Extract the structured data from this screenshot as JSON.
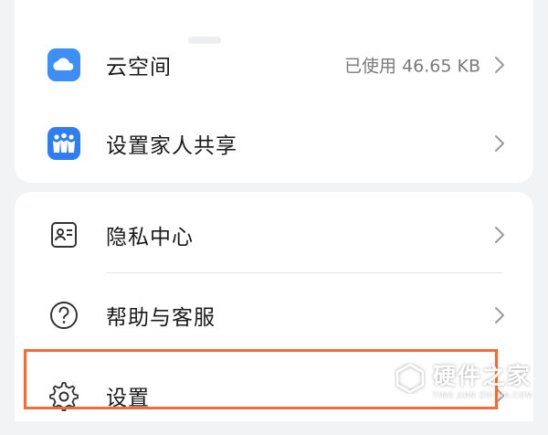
{
  "menu": {
    "cloud": {
      "label": "云空间",
      "value": "已使用 46.65 KB"
    },
    "family": {
      "label": "设置家人共享"
    },
    "privacy": {
      "label": "隐私中心"
    },
    "help": {
      "label": "帮助与客服"
    },
    "settings": {
      "label": "设置"
    }
  },
  "watermark": {
    "title": "硬件之家",
    "subtitle": "YING JIAN ZHI JIA.COM"
  },
  "colors": {
    "cloud_icon": "#3d8ef5",
    "family_icon": "#2f7ef0",
    "highlight_border": "#ee6d3a",
    "chevron": "#9a9a9a"
  },
  "icons": {
    "cloud": "cloud-icon",
    "family": "family-share-icon",
    "privacy": "privacy-id-card-icon",
    "help": "question-circle-icon",
    "settings": "gear-icon",
    "chevron": "chevron-right-icon"
  }
}
